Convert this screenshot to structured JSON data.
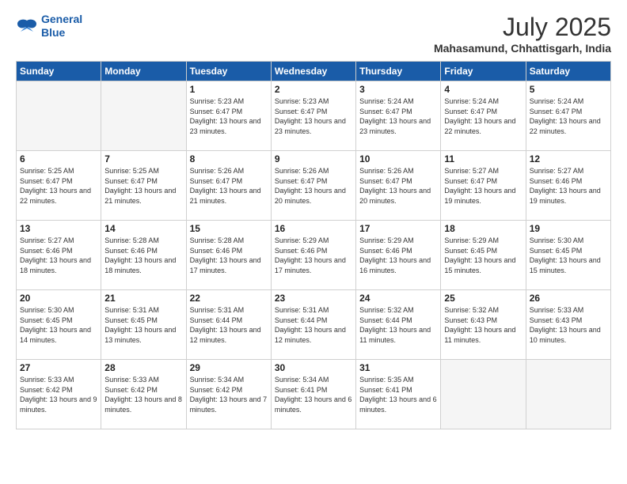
{
  "logo": {
    "line1": "General",
    "line2": "Blue"
  },
  "title": "July 2025",
  "location": "Mahasamund, Chhattisgarh, India",
  "days_of_week": [
    "Sunday",
    "Monday",
    "Tuesday",
    "Wednesday",
    "Thursday",
    "Friday",
    "Saturday"
  ],
  "weeks": [
    [
      {
        "day": "",
        "sunrise": "",
        "sunset": "",
        "daylight": ""
      },
      {
        "day": "",
        "sunrise": "",
        "sunset": "",
        "daylight": ""
      },
      {
        "day": "1",
        "sunrise": "Sunrise: 5:23 AM",
        "sunset": "Sunset: 6:47 PM",
        "daylight": "Daylight: 13 hours and 23 minutes."
      },
      {
        "day": "2",
        "sunrise": "Sunrise: 5:23 AM",
        "sunset": "Sunset: 6:47 PM",
        "daylight": "Daylight: 13 hours and 23 minutes."
      },
      {
        "day": "3",
        "sunrise": "Sunrise: 5:24 AM",
        "sunset": "Sunset: 6:47 PM",
        "daylight": "Daylight: 13 hours and 23 minutes."
      },
      {
        "day": "4",
        "sunrise": "Sunrise: 5:24 AM",
        "sunset": "Sunset: 6:47 PM",
        "daylight": "Daylight: 13 hours and 22 minutes."
      },
      {
        "day": "5",
        "sunrise": "Sunrise: 5:24 AM",
        "sunset": "Sunset: 6:47 PM",
        "daylight": "Daylight: 13 hours and 22 minutes."
      }
    ],
    [
      {
        "day": "6",
        "sunrise": "Sunrise: 5:25 AM",
        "sunset": "Sunset: 6:47 PM",
        "daylight": "Daylight: 13 hours and 22 minutes."
      },
      {
        "day": "7",
        "sunrise": "Sunrise: 5:25 AM",
        "sunset": "Sunset: 6:47 PM",
        "daylight": "Daylight: 13 hours and 21 minutes."
      },
      {
        "day": "8",
        "sunrise": "Sunrise: 5:26 AM",
        "sunset": "Sunset: 6:47 PM",
        "daylight": "Daylight: 13 hours and 21 minutes."
      },
      {
        "day": "9",
        "sunrise": "Sunrise: 5:26 AM",
        "sunset": "Sunset: 6:47 PM",
        "daylight": "Daylight: 13 hours and 20 minutes."
      },
      {
        "day": "10",
        "sunrise": "Sunrise: 5:26 AM",
        "sunset": "Sunset: 6:47 PM",
        "daylight": "Daylight: 13 hours and 20 minutes."
      },
      {
        "day": "11",
        "sunrise": "Sunrise: 5:27 AM",
        "sunset": "Sunset: 6:47 PM",
        "daylight": "Daylight: 13 hours and 19 minutes."
      },
      {
        "day": "12",
        "sunrise": "Sunrise: 5:27 AM",
        "sunset": "Sunset: 6:46 PM",
        "daylight": "Daylight: 13 hours and 19 minutes."
      }
    ],
    [
      {
        "day": "13",
        "sunrise": "Sunrise: 5:27 AM",
        "sunset": "Sunset: 6:46 PM",
        "daylight": "Daylight: 13 hours and 18 minutes."
      },
      {
        "day": "14",
        "sunrise": "Sunrise: 5:28 AM",
        "sunset": "Sunset: 6:46 PM",
        "daylight": "Daylight: 13 hours and 18 minutes."
      },
      {
        "day": "15",
        "sunrise": "Sunrise: 5:28 AM",
        "sunset": "Sunset: 6:46 PM",
        "daylight": "Daylight: 13 hours and 17 minutes."
      },
      {
        "day": "16",
        "sunrise": "Sunrise: 5:29 AM",
        "sunset": "Sunset: 6:46 PM",
        "daylight": "Daylight: 13 hours and 17 minutes."
      },
      {
        "day": "17",
        "sunrise": "Sunrise: 5:29 AM",
        "sunset": "Sunset: 6:46 PM",
        "daylight": "Daylight: 13 hours and 16 minutes."
      },
      {
        "day": "18",
        "sunrise": "Sunrise: 5:29 AM",
        "sunset": "Sunset: 6:45 PM",
        "daylight": "Daylight: 13 hours and 15 minutes."
      },
      {
        "day": "19",
        "sunrise": "Sunrise: 5:30 AM",
        "sunset": "Sunset: 6:45 PM",
        "daylight": "Daylight: 13 hours and 15 minutes."
      }
    ],
    [
      {
        "day": "20",
        "sunrise": "Sunrise: 5:30 AM",
        "sunset": "Sunset: 6:45 PM",
        "daylight": "Daylight: 13 hours and 14 minutes."
      },
      {
        "day": "21",
        "sunrise": "Sunrise: 5:31 AM",
        "sunset": "Sunset: 6:45 PM",
        "daylight": "Daylight: 13 hours and 13 minutes."
      },
      {
        "day": "22",
        "sunrise": "Sunrise: 5:31 AM",
        "sunset": "Sunset: 6:44 PM",
        "daylight": "Daylight: 13 hours and 12 minutes."
      },
      {
        "day": "23",
        "sunrise": "Sunrise: 5:31 AM",
        "sunset": "Sunset: 6:44 PM",
        "daylight": "Daylight: 13 hours and 12 minutes."
      },
      {
        "day": "24",
        "sunrise": "Sunrise: 5:32 AM",
        "sunset": "Sunset: 6:44 PM",
        "daylight": "Daylight: 13 hours and 11 minutes."
      },
      {
        "day": "25",
        "sunrise": "Sunrise: 5:32 AM",
        "sunset": "Sunset: 6:43 PM",
        "daylight": "Daylight: 13 hours and 11 minutes."
      },
      {
        "day": "26",
        "sunrise": "Sunrise: 5:33 AM",
        "sunset": "Sunset: 6:43 PM",
        "daylight": "Daylight: 13 hours and 10 minutes."
      }
    ],
    [
      {
        "day": "27",
        "sunrise": "Sunrise: 5:33 AM",
        "sunset": "Sunset: 6:42 PM",
        "daylight": "Daylight: 13 hours and 9 minutes."
      },
      {
        "day": "28",
        "sunrise": "Sunrise: 5:33 AM",
        "sunset": "Sunset: 6:42 PM",
        "daylight": "Daylight: 13 hours and 8 minutes."
      },
      {
        "day": "29",
        "sunrise": "Sunrise: 5:34 AM",
        "sunset": "Sunset: 6:42 PM",
        "daylight": "Daylight: 13 hours and 7 minutes."
      },
      {
        "day": "30",
        "sunrise": "Sunrise: 5:34 AM",
        "sunset": "Sunset: 6:41 PM",
        "daylight": "Daylight: 13 hours and 6 minutes."
      },
      {
        "day": "31",
        "sunrise": "Sunrise: 5:35 AM",
        "sunset": "Sunset: 6:41 PM",
        "daylight": "Daylight: 13 hours and 6 minutes."
      },
      {
        "day": "",
        "sunrise": "",
        "sunset": "",
        "daylight": ""
      },
      {
        "day": "",
        "sunrise": "",
        "sunset": "",
        "daylight": ""
      }
    ]
  ]
}
